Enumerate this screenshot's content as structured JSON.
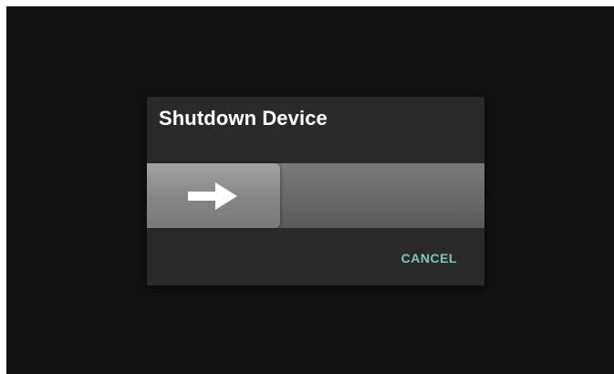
{
  "dialog": {
    "title": "Shutdown Device",
    "slider": {
      "icon": "arrow-right-icon",
      "position": 0
    },
    "cancel_label": "CANCEL"
  },
  "colors": {
    "background": "#111111",
    "dialog": "#2a2a2a",
    "accent": "#7fc6bf"
  }
}
